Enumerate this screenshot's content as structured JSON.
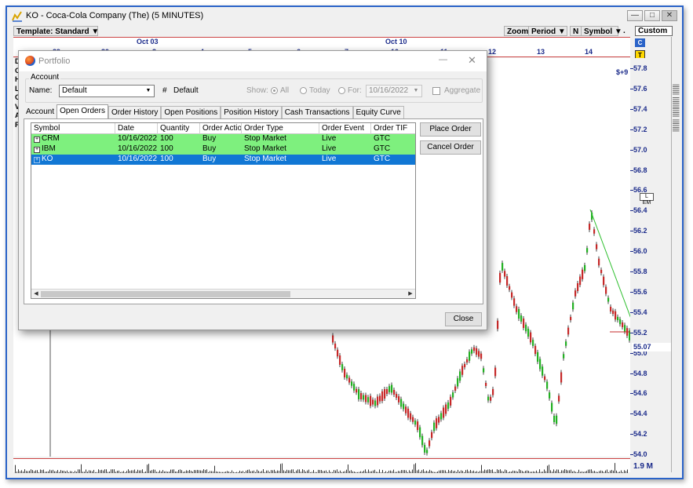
{
  "window": {
    "title": "KO - Coca-Cola Company (The) (5 MINUTES)"
  },
  "toolbar": {
    "template": "Template: Standard",
    "zoom": "Zoom",
    "period": "Period",
    "n": "N",
    "symbol": "Symbol",
    "dot": ".",
    "custom": "Custom"
  },
  "date_axis": {
    "months": [
      "Oct 03",
      "Oct 10"
    ],
    "days": [
      "29",
      "30",
      "3",
      "4",
      "5",
      "6",
      "7",
      "10",
      "11",
      "12",
      "13",
      "14"
    ]
  },
  "price_axis": {
    "ticks": [
      "57.8",
      "57.6",
      "57.4",
      "57.2",
      "57.0",
      "56.8",
      "56.6",
      "56.4",
      "56.2",
      "56.0",
      "55.8",
      "55.6",
      "55.4",
      "55.2",
      "55.0",
      "54.8",
      "54.6",
      "54.4",
      "54.2",
      "54.0"
    ],
    "last_price": "55.07",
    "volume_label": "1.9 M",
    "plus_label": "$+9",
    "c_badge": "C",
    "t_badge": "T",
    "scale_marker": "L  EM"
  },
  "left_letters": [
    "D",
    "O",
    "H",
    "L",
    "C",
    "V",
    "A",
    "P"
  ],
  "portfolio": {
    "title": "Portfolio",
    "min_glyph": "—",
    "close_glyph": "✕",
    "account_group_label": "Account",
    "name_label": "Name:",
    "name_value": "Default",
    "hash_label": "#",
    "hash_value": "Default",
    "show_label": "Show:",
    "show_all": "All",
    "show_today": "Today",
    "show_for": "For:",
    "for_date": "10/16/2022",
    "aggregate": "Aggregate",
    "tabs": [
      "Account",
      "Open Orders",
      "Order History",
      "Open Positions",
      "Position History",
      "Cash Transactions",
      "Equity Curve"
    ],
    "active_tab": "Open Orders",
    "columns": [
      "Symbol",
      "Date",
      "Quantity",
      "Order Actio",
      "Order Type",
      "Order Event",
      "Order TIF"
    ],
    "orders": [
      {
        "symbol": "CRM",
        "date": "10/16/2022",
        "quantity": "100",
        "action": "Buy",
        "type": "Stop Market",
        "event": "Live",
        "tif": "GTC"
      },
      {
        "symbol": "IBM",
        "date": "10/16/2022",
        "quantity": "100",
        "action": "Buy",
        "type": "Stop Market",
        "event": "Live",
        "tif": "GTC"
      },
      {
        "symbol": "KO",
        "date": "10/16/2022",
        "quantity": "100",
        "action": "Buy",
        "type": "Stop Market",
        "event": "Live",
        "tif": "GTC"
      }
    ],
    "place_order": "Place Order",
    "cancel_order": "Cancel Order",
    "close": "Close",
    "expander": "+"
  }
}
